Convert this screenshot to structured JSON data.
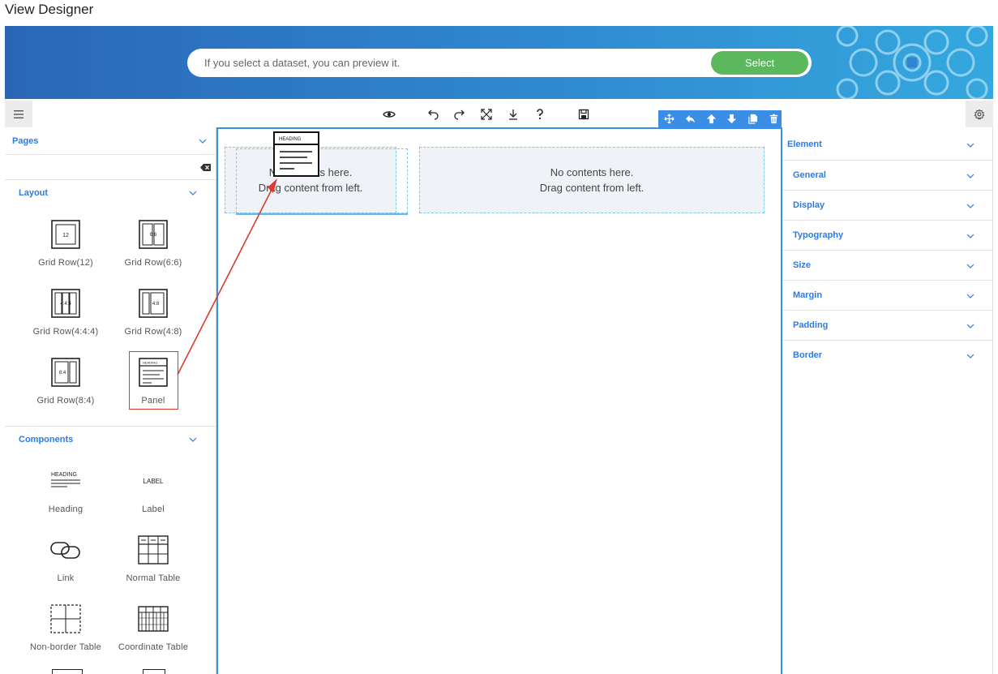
{
  "page_title": "View Designer",
  "banner": {
    "placeholder": "If you select a dataset, you can preview it.",
    "select_label": "Select",
    "accent": "#5cb85c"
  },
  "toolbar": {
    "icons": [
      "preview-icon",
      "undo-icon",
      "redo-icon",
      "fullscreen-icon",
      "download-icon",
      "help-icon",
      "save-icon"
    ],
    "selection_icons": [
      "move-icon",
      "select-parent-icon",
      "move-up-icon",
      "move-down-icon",
      "copy-icon",
      "delete-icon"
    ]
  },
  "sidebar": {
    "pages_label": "Pages",
    "layout_label": "Layout",
    "components_label": "Components",
    "layout_items": [
      {
        "label": "Grid Row(12)",
        "glyph": "12"
      },
      {
        "label": "Grid Row(6:6)",
        "glyph": "6:6"
      },
      {
        "label": "Grid Row(4:4:4)",
        "glyph": "4:4:4"
      },
      {
        "label": "Grid Row(4:8)",
        "glyph": "4:8"
      },
      {
        "label": "Grid Row(8:4)",
        "glyph": "8:4"
      },
      {
        "label": "Panel",
        "glyph": "HEADING"
      }
    ],
    "component_items": [
      {
        "label": "Heading",
        "glyph": "HEADING"
      },
      {
        "label": "Label",
        "glyph": "LABEL"
      },
      {
        "label": "Link"
      },
      {
        "label": "Normal Table"
      },
      {
        "label": "Non-border Table"
      },
      {
        "label": "Coordinate Table"
      }
    ]
  },
  "canvas": {
    "zone_left": {
      "line1": "No contents here.",
      "line2": "Drag content from left."
    },
    "zone_right": {
      "line1": "No contents here.",
      "line2": "Drag content from left."
    },
    "ghost_glyph": "HEADING"
  },
  "properties": {
    "sections": [
      "Element",
      "General",
      "Display",
      "Typography",
      "Size",
      "Margin",
      "Padding",
      "Border"
    ]
  },
  "colors": {
    "accent_blue": "#2c7be5",
    "selection_blue": "#3a8ee6",
    "highlight_red": "#e0392b"
  }
}
